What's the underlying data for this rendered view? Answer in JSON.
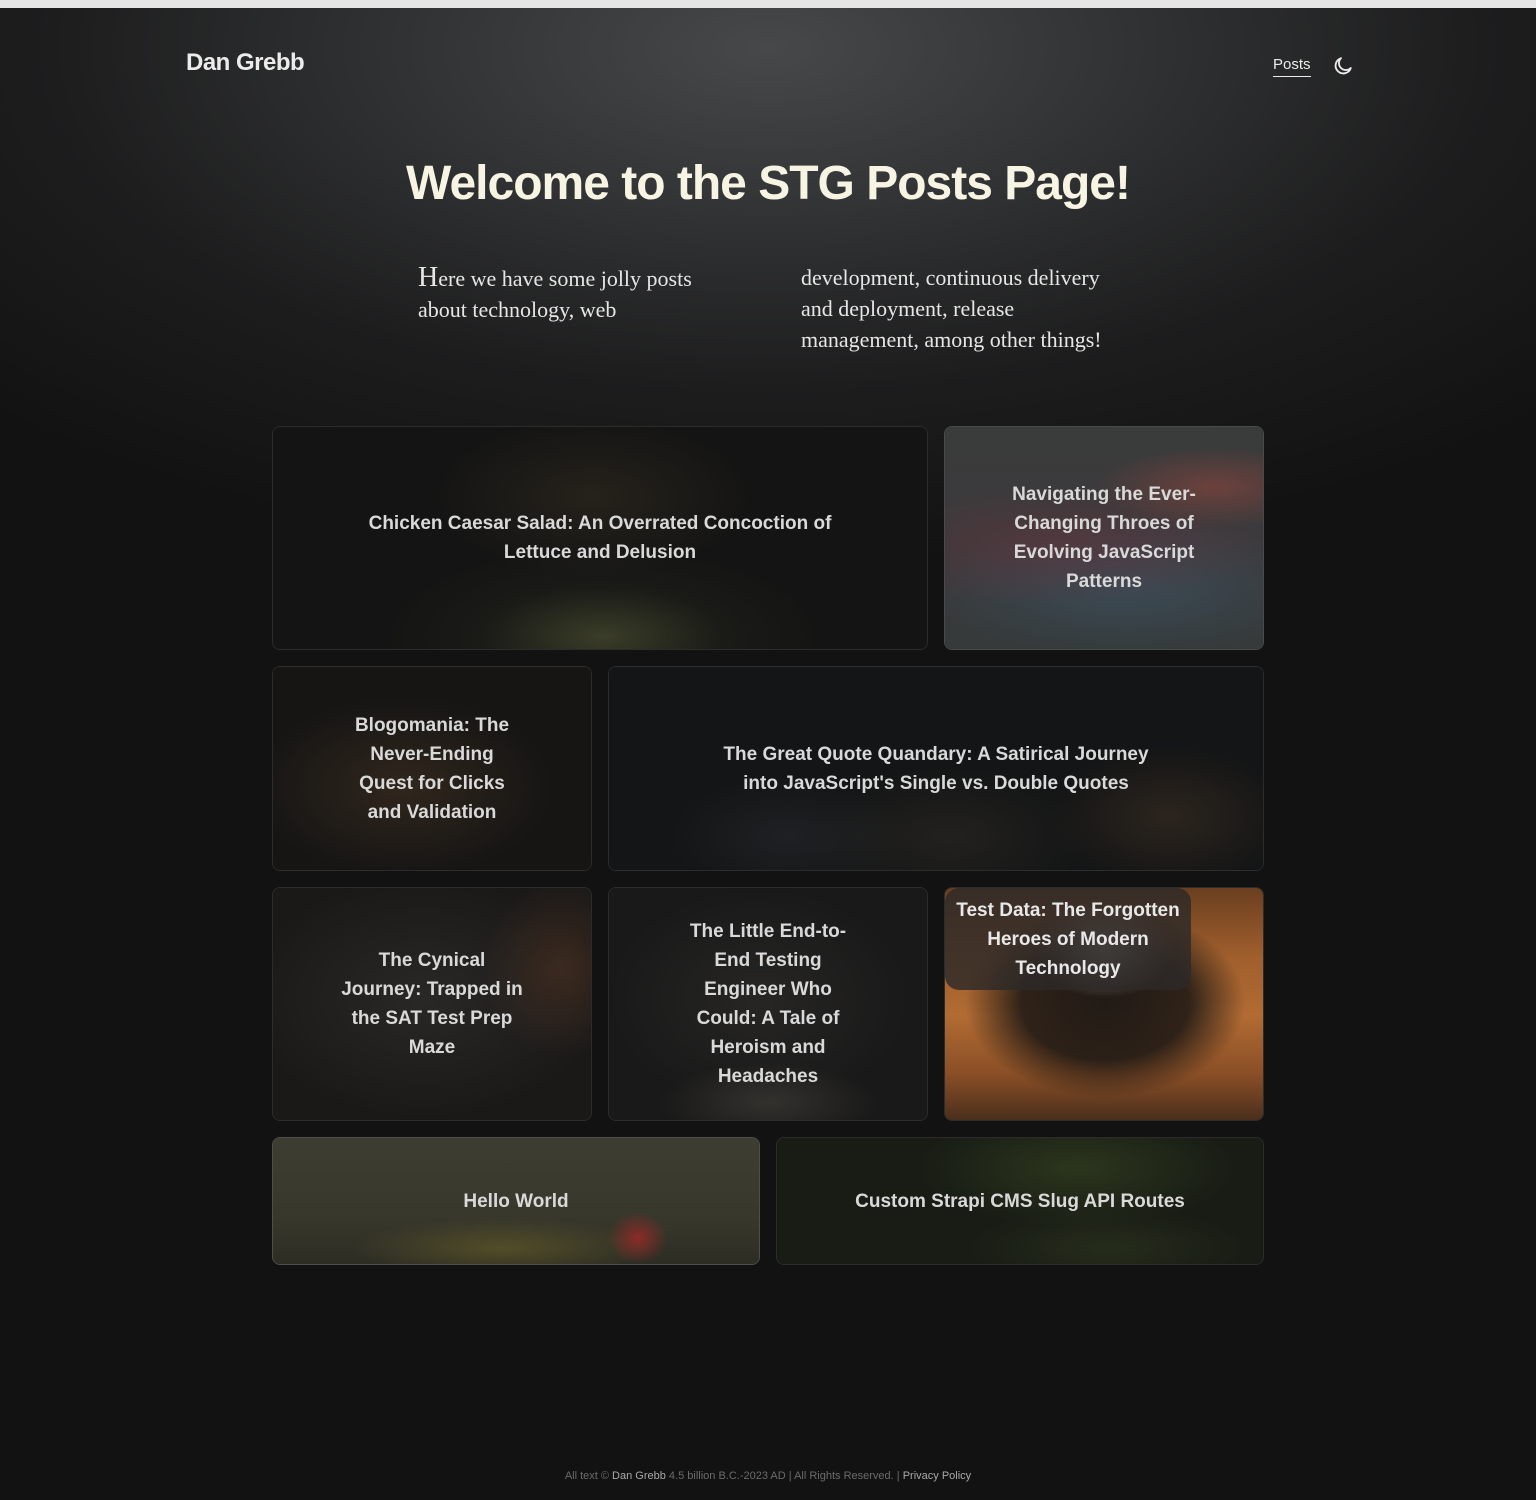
{
  "header": {
    "logo": "Dan Grebb",
    "nav_posts": "Posts",
    "theme_toggle_icon": "moon-icon"
  },
  "hero": {
    "title": "Welcome to the STG Posts Page!",
    "intro_first_letter": "H",
    "intro_rest": "ere we have some jolly posts about technology, web development, continuous delivery and deployment, release management, among other things!"
  },
  "posts": [
    {
      "title": "Chicken Caesar Salad: An Overrated Concoction of Lettuce and Delusion"
    },
    {
      "title": "Navigating the Ever-Changing Throes of Evolving JavaScript Patterns"
    },
    {
      "title": "Blogomania: The Never-Ending Quest for Clicks and Validation"
    },
    {
      "title": "The Great Quote Quandary: A Satirical Journey into JavaScript's Single vs. Double Quotes"
    },
    {
      "title": "The Cynical Journey: Trapped in the SAT Test Prep Maze"
    },
    {
      "title": "The Little End-to-End Testing Engineer Who Could: A Tale of Heroism and Headaches"
    },
    {
      "title": "Test Data: The Forgotten Heroes of Modern Technology"
    },
    {
      "title": "Hello World"
    },
    {
      "title": "Custom Strapi CMS Slug API Routes"
    }
  ],
  "footer": {
    "prefix": "All text ©",
    "author": "Dan Grebb",
    "span": "4.5 billion B.C.-2023 AD | All Rights Reserved. |",
    "privacy": "Privacy Policy"
  }
}
